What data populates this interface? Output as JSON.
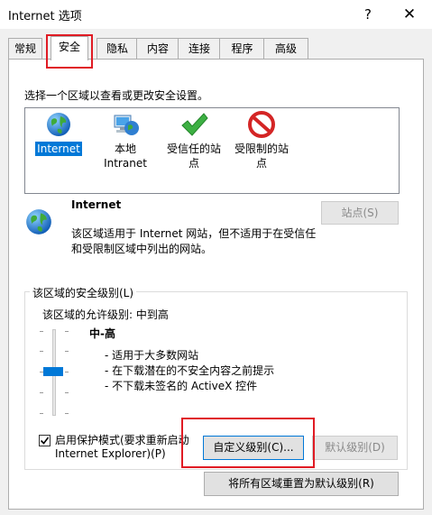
{
  "window": {
    "title": "Internet 选项",
    "help": "?",
    "close": "✕"
  },
  "tabs": [
    {
      "label": "常规"
    },
    {
      "label": "安全"
    },
    {
      "label": "隐私"
    },
    {
      "label": "内容"
    },
    {
      "label": "连接"
    },
    {
      "label": "程序"
    },
    {
      "label": "高级"
    }
  ],
  "active_tab": "安全",
  "instruction": "选择一个区域以查看或更改安全设置。",
  "zones": [
    {
      "line1": "Internet",
      "line2": "",
      "icon": "globe-icon",
      "selected": true
    },
    {
      "line1": "本地",
      "line2": "Intranet",
      "icon": "intranet-icon",
      "selected": false
    },
    {
      "line1": "受信任的站",
      "line2": "点",
      "icon": "check-icon",
      "selected": false
    },
    {
      "line1": "受限制的站",
      "line2": "点",
      "icon": "no-entry-icon",
      "selected": false
    }
  ],
  "zone_info": {
    "name": "Internet",
    "desc1": "该区域适用于 Internet 网站，但不适用于在受信任",
    "desc2": "和受限制区域中列出的网站。",
    "sites_button": "站点(S)"
  },
  "security_level": {
    "group_label": "该区域的安全级别(L)",
    "allowed": "该区域的允许级别: 中到高",
    "level_name": "中-高",
    "bullets": [
      "- 适用于大多数网站",
      "- 在下载潜在的不安全内容之前提示",
      "- 不下载未签名的 ActiveX 控件"
    ],
    "protected_mode_line1": "启用保护模式(要求重新启动",
    "protected_mode_line2": "Internet Explorer)(P)",
    "protected_mode_checked": true,
    "custom_button": "自定义级别(C)...",
    "default_button": "默认级别(D)"
  },
  "reset_button": "将所有区域重置为默认级别(R)",
  "colors": {
    "highlight": "#e01b24",
    "selection": "#0078d7"
  }
}
